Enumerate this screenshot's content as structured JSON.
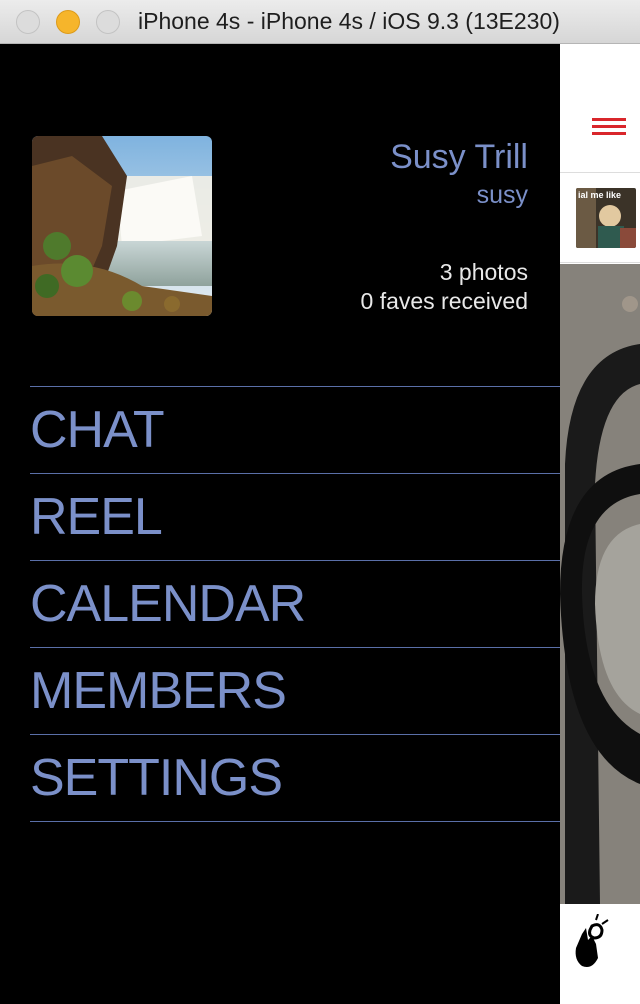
{
  "window": {
    "title": "iPhone 4s - iPhone 4s / iOS 9.3 (13E230)"
  },
  "profile": {
    "name": "Susy Trill",
    "username": "susy",
    "photos": "3 photos",
    "faves": "0 faves received"
  },
  "menu": {
    "items": [
      "CHAT",
      "REEL",
      "CALENDAR",
      "MEMBERS",
      "SETTINGS"
    ]
  },
  "peek": {
    "thumbnail_caption": "ial me like"
  },
  "colors": {
    "accent": "#7b90c9",
    "hamburger": "#d9262b",
    "background": "#000000"
  }
}
